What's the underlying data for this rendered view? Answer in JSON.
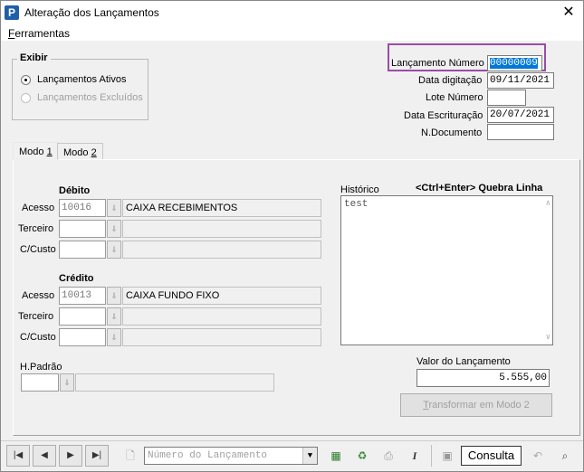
{
  "window": {
    "title": "Alteração dos Lançamentos",
    "close": "✕",
    "app_icon": "P"
  },
  "menu": {
    "item_first": "F",
    "item_rest": "erramentas"
  },
  "exibir": {
    "label": "Exibir",
    "opt_ativos": "Lançamentos Ativos",
    "opt_excluidos": "Lançamentos Excluídos"
  },
  "header": {
    "lanc_numero_label": "Lançamento Número",
    "lanc_numero_value": "00000009",
    "data_dig_label": "Data digitação",
    "data_dig_value": "09/11/2021",
    "lote_label": "Lote Número",
    "lote_value": "",
    "data_escr_label": "Data Escrituração",
    "data_escr_value": "20/07/2021",
    "ndoc_label": "N.Documento",
    "ndoc_value": ""
  },
  "tabs": [
    {
      "pre": "Modo ",
      "ul": "1"
    },
    {
      "pre": "Modo ",
      "ul": "2"
    }
  ],
  "debito": {
    "title": "Débito",
    "acesso_label": "Acesso",
    "acesso_code": "10016",
    "acesso_desc": "CAIXA RECEBIMENTOS",
    "terceiro_label": "Terceiro",
    "ccusto_label": "C/Custo"
  },
  "credito": {
    "title": "Crédito",
    "acesso_label": "Acesso",
    "acesso_code": "10013",
    "acesso_desc": "CAIXA FUNDO FIXO",
    "terceiro_label": "Terceiro",
    "ccusto_label": "C/Custo"
  },
  "historico": {
    "label": "Histórico",
    "hint": "<Ctrl+Enter> Quebra Linha",
    "text": "test"
  },
  "hpadrao": {
    "label": "H.Padrão"
  },
  "valor": {
    "label": "Valor do Lançamento",
    "value": "5.555,00"
  },
  "transformar": {
    "ul": "T",
    "rest": "ransformar em  Modo 2"
  },
  "toolbar": {
    "first": "|◀",
    "prev": "◀",
    "next": "▶",
    "last": "▶|",
    "search_placeholder": "Número do Lançamento",
    "consulta": "Consulta",
    "italic": "I"
  }
}
